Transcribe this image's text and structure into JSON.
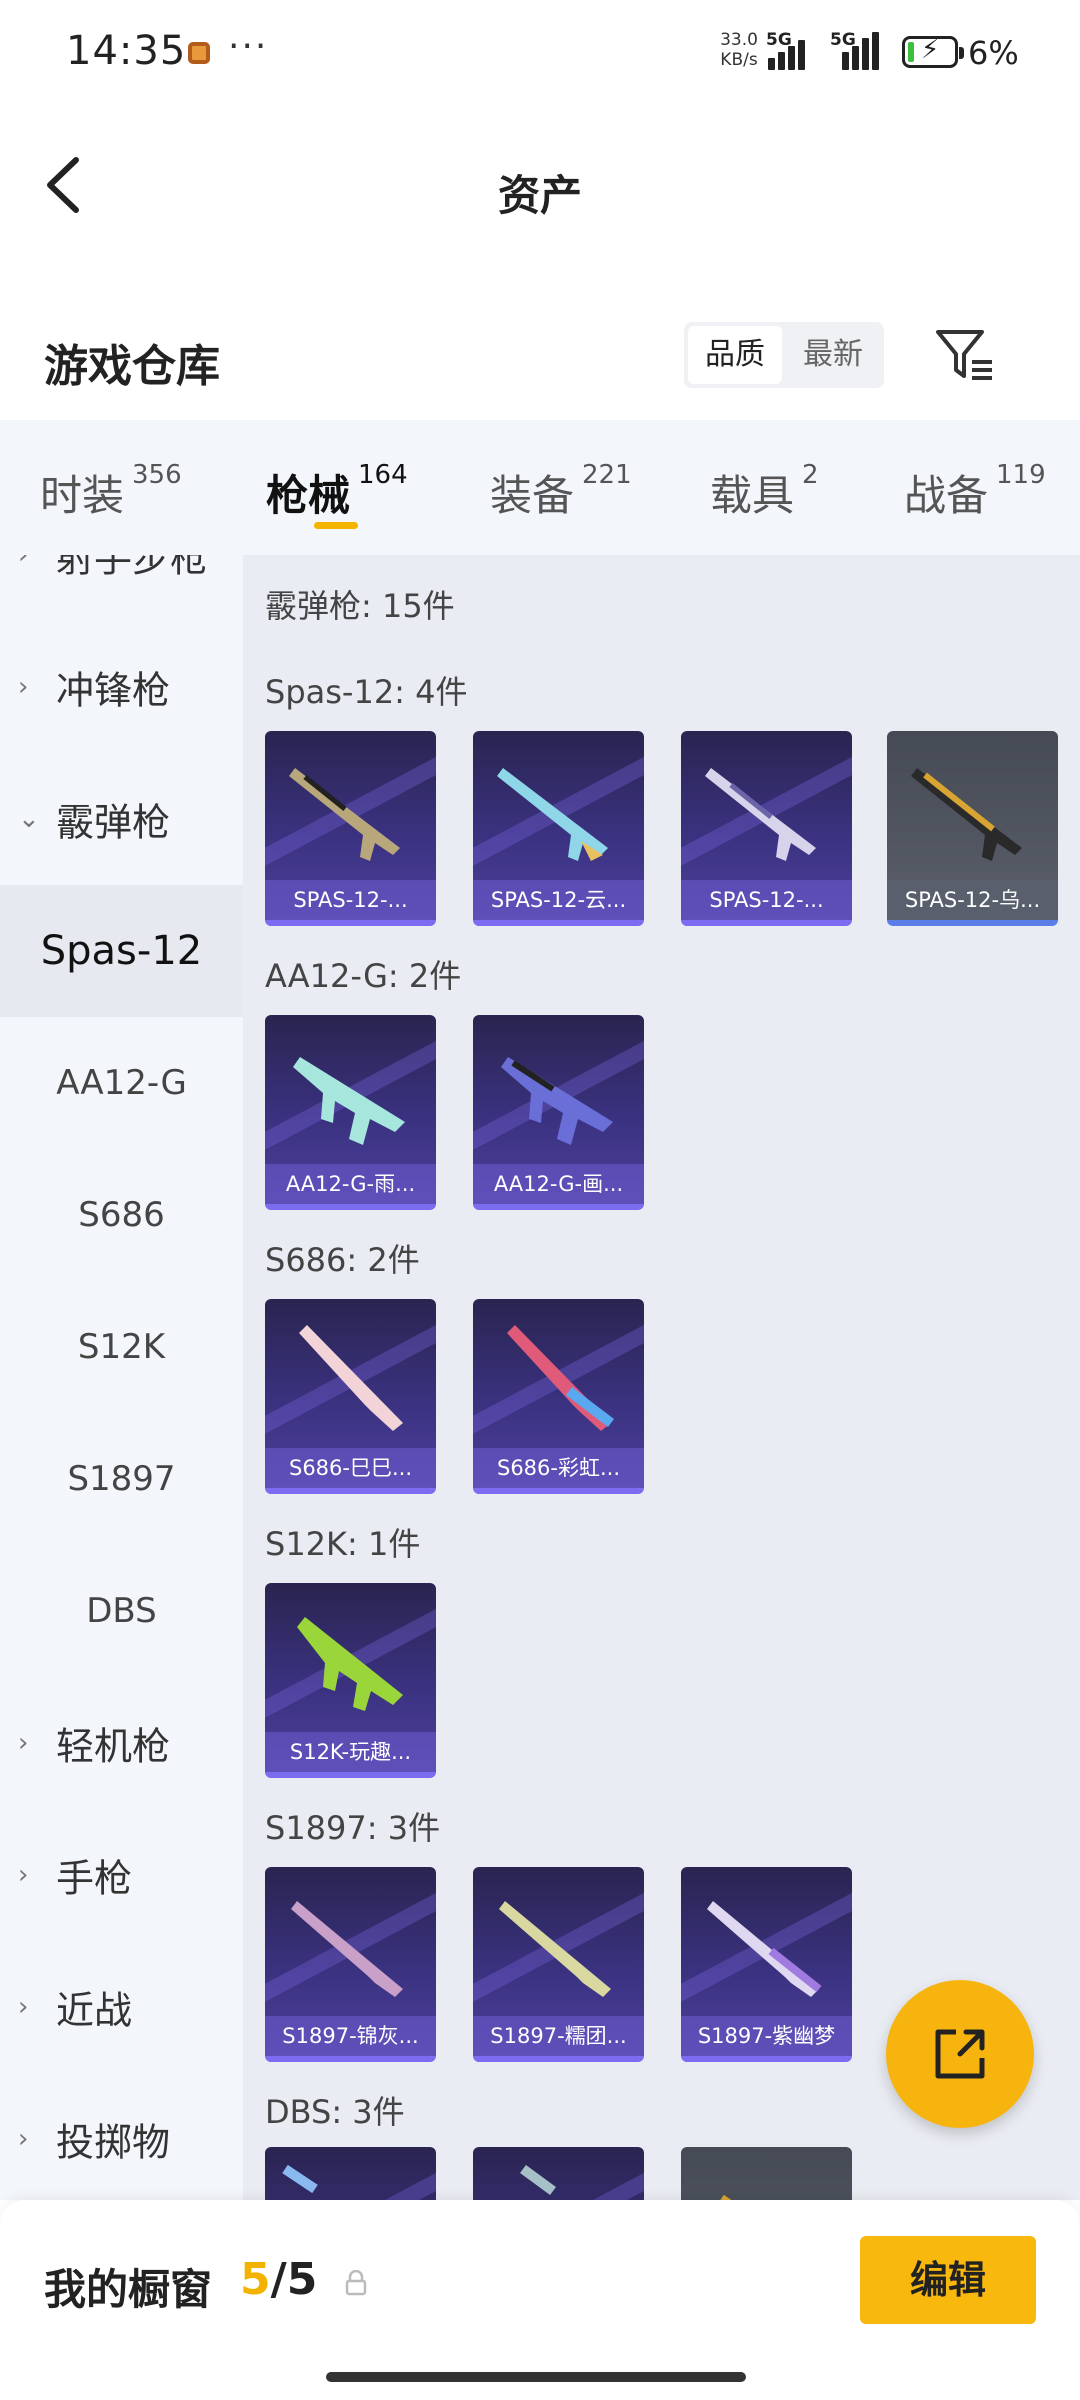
{
  "status_bar": {
    "time": "14:35",
    "net_speed_top": "33.0",
    "net_speed_bottom": "KB/s",
    "sig1_label": "5G",
    "sig2_label": "5G",
    "battery": "6%"
  },
  "nav": {
    "title": "资产",
    "back_icon": "chevron-left-icon"
  },
  "warehouse": {
    "title": "游戏仓库",
    "sort_options": [
      "品质",
      "最新"
    ],
    "sort_selected": "品质",
    "filter_icon": "filter-icon"
  },
  "tabs": [
    {
      "label": "时装",
      "count": "356"
    },
    {
      "label": "枪械",
      "count": "164"
    },
    {
      "label": "装备",
      "count": "221"
    },
    {
      "label": "载具",
      "count": "2"
    },
    {
      "label": "战备",
      "count": "119"
    }
  ],
  "active_tab": "枪械",
  "sidebar": {
    "items": [
      {
        "label": "射手步枪",
        "chev": "›"
      },
      {
        "label": "冲锋枪",
        "chev": "›"
      },
      {
        "label": "霰弹枪",
        "chev": "⌄"
      },
      {
        "label": "Spas-12"
      },
      {
        "label": "AA12-G"
      },
      {
        "label": "S686"
      },
      {
        "label": "S12K"
      },
      {
        "label": "S1897"
      },
      {
        "label": "DBS"
      },
      {
        "label": "轻机枪",
        "chev": "›"
      },
      {
        "label": "手枪",
        "chev": "›"
      },
      {
        "label": "近战",
        "chev": "›"
      },
      {
        "label": "投掷物",
        "chev": "›"
      }
    ]
  },
  "main": {
    "category_header": "霰弹枪: 15件",
    "groups": [
      {
        "header": "Spas-12: 4件",
        "items": [
          "SPAS-12-...",
          "SPAS-12-云...",
          "SPAS-12-...",
          "SPAS-12-乌..."
        ]
      },
      {
        "header": "AA12-G: 2件",
        "items": [
          "AA12-G-雨...",
          "AA12-G-画..."
        ]
      },
      {
        "header": "S686: 2件",
        "items": [
          "S686-巳巳...",
          "S686-彩虹..."
        ]
      },
      {
        "header": "S12K: 1件",
        "items": [
          "S12K-玩趣..."
        ]
      },
      {
        "header": "S1897: 3件",
        "items": [
          "S1897-锦灰...",
          "S1897-糯团...",
          "S1897-紫幽梦"
        ]
      },
      {
        "header": "DBS: 3件",
        "items": [
          "",
          "",
          ""
        ]
      }
    ]
  },
  "fab": {
    "icon": "share-external-icon"
  },
  "bottom": {
    "title": "我的橱窗",
    "count_current": "5",
    "count_sep": "/",
    "count_total": "5",
    "lock_icon": "lock-icon",
    "edit_label": "编辑"
  },
  "colors": {
    "accent": "#f8b40e",
    "card_purple": "#3a3280",
    "card_grey": "#5a5f6a"
  }
}
